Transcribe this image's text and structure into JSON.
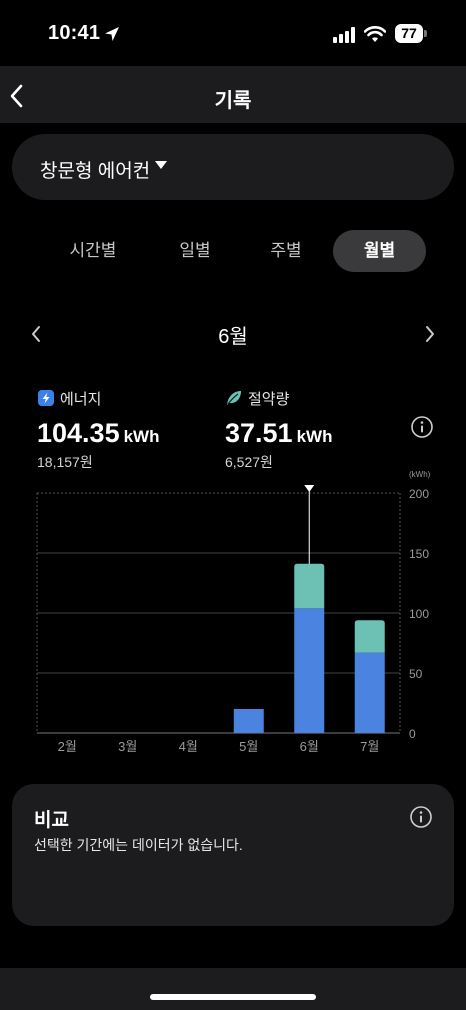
{
  "status_bar": {
    "time": "10:41",
    "battery": "77"
  },
  "nav": {
    "title": "기록"
  },
  "device": {
    "name": "창문형 에어컨"
  },
  "tabs": {
    "hour": "시간별",
    "day": "일별",
    "week": "주별",
    "month": "월별"
  },
  "period": {
    "label": "6월"
  },
  "stats": {
    "energy": {
      "label": "에너지",
      "value": "104.35",
      "unit": "kWh",
      "cost": "18,157원"
    },
    "saving": {
      "label": "절약량",
      "value": "37.51",
      "unit": "kWh",
      "cost": "6,527원"
    }
  },
  "chart_data": {
    "type": "bar",
    "categories": [
      "2월",
      "3월",
      "4월",
      "5월",
      "6월",
      "7월"
    ],
    "series": [
      {
        "name": "에너지",
        "values": [
          0,
          0,
          0,
          20,
          104,
          67
        ]
      },
      {
        "name": "절약량",
        "values": [
          0,
          0,
          0,
          0,
          37,
          27
        ]
      }
    ],
    "ylim": [
      0,
      200
    ],
    "yticks": [
      "200",
      "150",
      "100",
      "50",
      "0"
    ],
    "unit_label": "(kWh)",
    "selected_index": 4,
    "colors": {
      "energy": "#4a84e0",
      "saving": "#6cc0b4"
    }
  },
  "compare": {
    "title": "비교",
    "message": "선택한 기간에는 데이터가 없습니다."
  }
}
